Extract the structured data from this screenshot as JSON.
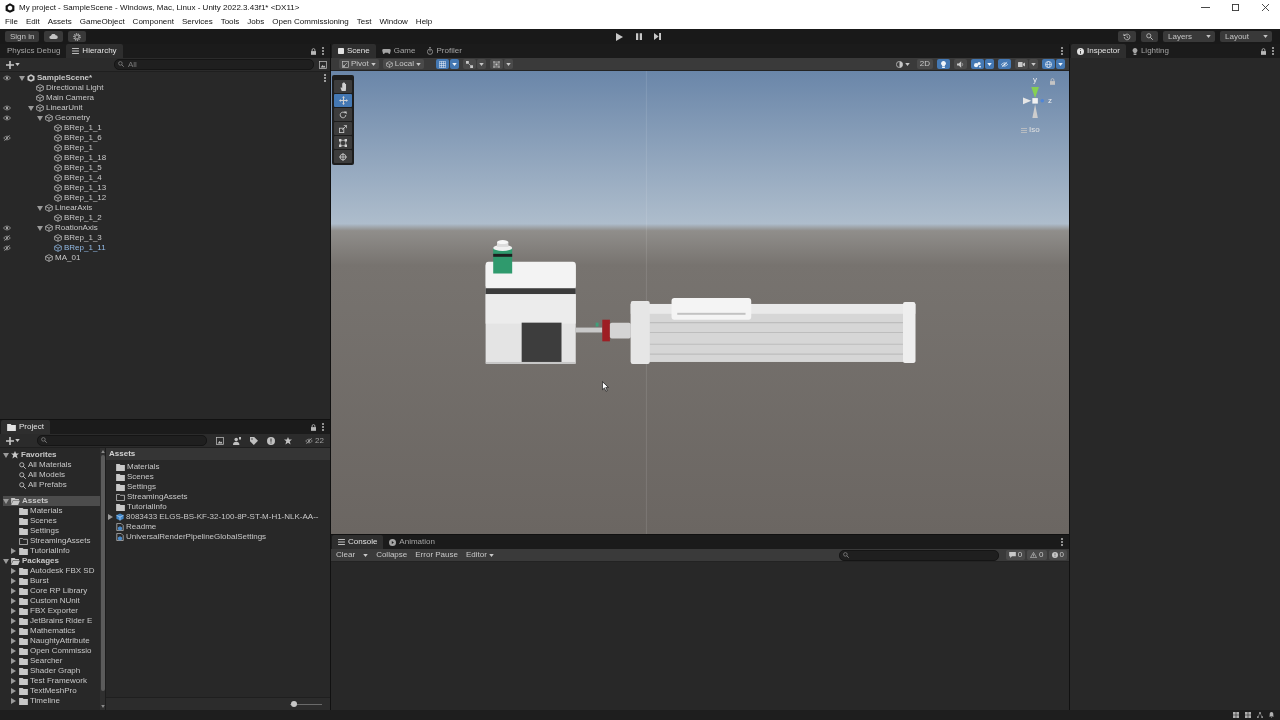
{
  "window": {
    "title": "My project - SampleScene - Windows, Mac, Linux - Unity 2022.3.43f1* <DX11>"
  },
  "menu": [
    "File",
    "Edit",
    "Assets",
    "GameObject",
    "Component",
    "Services",
    "Tools",
    "Jobs",
    "Open Commissioning",
    "Test",
    "Window",
    "Help"
  ],
  "toolbar": {
    "sign_in": "Sign in",
    "layers": "Layers",
    "layout": "Layout"
  },
  "hierarchy": {
    "tabs": [
      {
        "label": "Physics Debug",
        "selected": false
      },
      {
        "label": "Hierarchy",
        "selected": true
      }
    ],
    "search": {
      "placeholder": "All"
    },
    "tree": [
      {
        "label": "SampleScene*",
        "kind": "scene",
        "expanded": true,
        "selected": false,
        "hidden": false,
        "partly_hidden": true,
        "children": [
          {
            "label": "Directional Light",
            "kind": "object",
            "selected": false,
            "hidden": false,
            "partly_hidden": false
          },
          {
            "label": "Main Camera",
            "kind": "object",
            "selected": false,
            "hidden": false,
            "partly_hidden": false
          },
          {
            "label": "LinearUnit",
            "kind": "object",
            "expanded": true,
            "selected": false,
            "hidden": false,
            "partly_hidden": true,
            "children": [
              {
                "label": "Geometry",
                "kind": "object",
                "expanded": true,
                "selected": false,
                "hidden": false,
                "partly_hidden": true,
                "children": [
                  {
                    "label": "BRep_1_1",
                    "kind": "object",
                    "selected": false,
                    "hidden": false,
                    "partly_hidden": false
                  },
                  {
                    "label": "BRep_1_6",
                    "kind": "object",
                    "selected": false,
                    "hidden": true,
                    "partly_hidden": false
                  },
                  {
                    "label": "BRep_1",
                    "kind": "object",
                    "selected": false,
                    "hidden": false,
                    "partly_hidden": false
                  },
                  {
                    "label": "BRep_1_18",
                    "kind": "object",
                    "selected": false,
                    "hidden": false,
                    "partly_hidden": false
                  },
                  {
                    "label": "BRep_1_5",
                    "kind": "object",
                    "selected": false,
                    "hidden": false,
                    "partly_hidden": false
                  },
                  {
                    "label": "BRep_1_4",
                    "kind": "object",
                    "selected": false,
                    "hidden": false,
                    "partly_hidden": false
                  },
                  {
                    "label": "BRep_1_13",
                    "kind": "object",
                    "selected": false,
                    "hidden": false,
                    "partly_hidden": false
                  },
                  {
                    "label": "BRep_1_12",
                    "kind": "object",
                    "selected": false,
                    "hidden": false,
                    "partly_hidden": false
                  }
                ]
              },
              {
                "label": "LinearAxis",
                "kind": "object",
                "expanded": true,
                "selected": false,
                "hidden": false,
                "partly_hidden": false,
                "children": [
                  {
                    "label": "BRep_1_2",
                    "kind": "object",
                    "selected": false,
                    "hidden": false,
                    "partly_hidden": false
                  }
                ]
              },
              {
                "label": "RoationAxis",
                "kind": "object",
                "expanded": true,
                "selected": false,
                "hidden": false,
                "partly_hidden": true,
                "children": [
                  {
                    "label": "BRep_1_3",
                    "kind": "object",
                    "selected": false,
                    "hidden": true,
                    "partly_hidden": false
                  },
                  {
                    "label": "BRep_1_11",
                    "kind": "object",
                    "selected": true,
                    "hidden": true,
                    "partly_hidden": false
                  }
                ]
              },
              {
                "label": "MA_01",
                "kind": "object",
                "selected": false,
                "hidden": false,
                "partly_hidden": false
              }
            ]
          }
        ]
      }
    ]
  },
  "project": {
    "tabs": [
      {
        "label": "Project",
        "selected": true
      }
    ],
    "hidden_count": "22",
    "tree": [
      {
        "label": "Favorites",
        "kind": "favorites",
        "expanded": true,
        "selected": false,
        "children": [
          {
            "label": "All Materials",
            "kind": "saved-search",
            "selected": false
          },
          {
            "label": "All Models",
            "kind": "saved-search",
            "selected": false
          },
          {
            "label": "All Prefabs",
            "kind": "saved-search",
            "selected": false
          }
        ]
      },
      {
        "label": "Assets",
        "kind": "folder",
        "expanded": true,
        "selected": true,
        "children": [
          {
            "label": "Materials",
            "kind": "folder",
            "selected": false
          },
          {
            "label": "Scenes",
            "kind": "folder",
            "selected": false
          },
          {
            "label": "Settings",
            "kind": "folder",
            "selected": false
          },
          {
            "label": "StreamingAssets",
            "kind": "empty-folder",
            "selected": false
          },
          {
            "label": "TutorialInfo",
            "kind": "folder",
            "expanded": false,
            "selected": false
          }
        ]
      },
      {
        "label": "Packages",
        "kind": "folder",
        "expanded": true,
        "selected": false,
        "children": [
          {
            "label": "Autodesk FBX SD",
            "kind": "folder",
            "expanded": false,
            "selected": false
          },
          {
            "label": "Burst",
            "kind": "folder",
            "expanded": false,
            "selected": false
          },
          {
            "label": "Core RP Library",
            "kind": "folder",
            "expanded": false,
            "selected": false
          },
          {
            "label": "Custom NUnit",
            "kind": "folder",
            "expanded": false,
            "selected": false
          },
          {
            "label": "FBX Exporter",
            "kind": "folder",
            "expanded": false,
            "selected": false
          },
          {
            "label": "JetBrains Rider E",
            "kind": "folder",
            "expanded": false,
            "selected": false
          },
          {
            "label": "Mathematics",
            "kind": "folder",
            "expanded": false,
            "selected": false
          },
          {
            "label": "NaughtyAttribute",
            "kind": "folder",
            "expanded": false,
            "selected": false
          },
          {
            "label": "Open Commissio",
            "kind": "folder",
            "expanded": false,
            "selected": false
          },
          {
            "label": "Searcher",
            "kind": "folder",
            "expanded": false,
            "selected": false
          },
          {
            "label": "Shader Graph",
            "kind": "folder",
            "expanded": false,
            "selected": false
          },
          {
            "label": "Test Framework",
            "kind": "folder",
            "expanded": false,
            "selected": false
          },
          {
            "label": "TextMeshPro",
            "kind": "folder",
            "expanded": false,
            "selected": false
          },
          {
            "label": "Timeline",
            "kind": "folder",
            "expanded": false,
            "selected": false
          }
        ]
      }
    ],
    "path": "Assets",
    "items": [
      {
        "label": "Materials",
        "kind": "folder"
      },
      {
        "label": "Scenes",
        "kind": "folder"
      },
      {
        "label": "Settings",
        "kind": "folder"
      },
      {
        "label": "StreamingAssets",
        "kind": "empty-folder"
      },
      {
        "label": "TutorialInfo",
        "kind": "folder"
      },
      {
        "label": "8083433 ELGS-BS-KF-32-100-8P-ST-M-H1-NLK-AA--",
        "kind": "model",
        "expanded": false
      },
      {
        "label": "Readme",
        "kind": "asset"
      },
      {
        "label": "UniversalRenderPipelineGlobalSettings",
        "kind": "asset"
      }
    ],
    "zoom": {
      "level": 0.02
    }
  },
  "scene": {
    "tabs": [
      {
        "label": "Scene",
        "selected": true
      },
      {
        "label": "Game",
        "selected": false
      },
      {
        "label": "Profiler",
        "selected": false
      }
    ],
    "handle_position": "Pivot",
    "handle_rotation": "Local",
    "snap_toggles": [
      {
        "on": true
      },
      {
        "on": false
      },
      {
        "on": false
      }
    ],
    "view_toggles": [
      {
        "label": "2D",
        "on": false
      },
      {
        "on": true
      },
      {
        "on": false
      },
      {
        "on": true
      },
      {
        "on": true
      },
      {
        "on": false
      },
      {
        "on": true
      }
    ],
    "tools": [
      {
        "selected": false
      },
      {
        "selected": true
      },
      {
        "selected": false
      },
      {
        "selected": false
      },
      {
        "selected": false
      },
      {
        "selected": false
      }
    ],
    "gizmo": {
      "y_label": "y",
      "z_label": "z",
      "projection": "Iso"
    }
  },
  "console": {
    "tabs": [
      {
        "label": "Console",
        "selected": true
      },
      {
        "label": "Animation",
        "selected": false
      }
    ],
    "buttons": [
      {
        "label": "Clear",
        "kind": "split"
      },
      {
        "label": "Collapse",
        "kind": "toggle",
        "on": false
      },
      {
        "label": "Error Pause",
        "kind": "toggle",
        "on": false
      },
      {
        "label": "Editor",
        "kind": "dropdown"
      }
    ],
    "counts": [
      {
        "kind": "info",
        "count": "0"
      },
      {
        "kind": "warning",
        "count": "0"
      },
      {
        "kind": "error",
        "count": "0"
      }
    ]
  },
  "inspector": {
    "tabs": [
      {
        "label": "Inspector",
        "selected": true
      },
      {
        "label": "Lighting",
        "selected": false
      }
    ]
  }
}
